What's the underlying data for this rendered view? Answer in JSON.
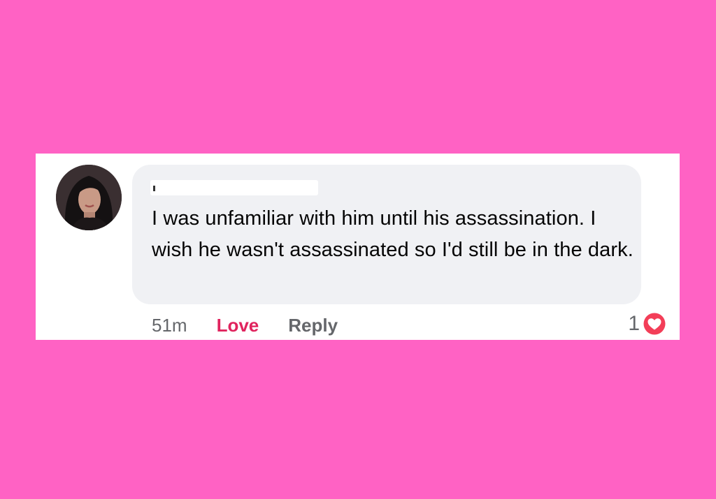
{
  "comment": {
    "text": "I was unfamiliar with him until his assassination. I wish he wasn't assassinated so I'd still be in the dark.",
    "time": "51m",
    "love_label": "Love",
    "reply_label": "Reply",
    "reaction_count": "1",
    "reaction_icon": "heart-icon"
  },
  "colors": {
    "background": "#ff62c4",
    "bubble": "#f0f1f4",
    "love": "#e0245e",
    "meta": "#65676b"
  }
}
